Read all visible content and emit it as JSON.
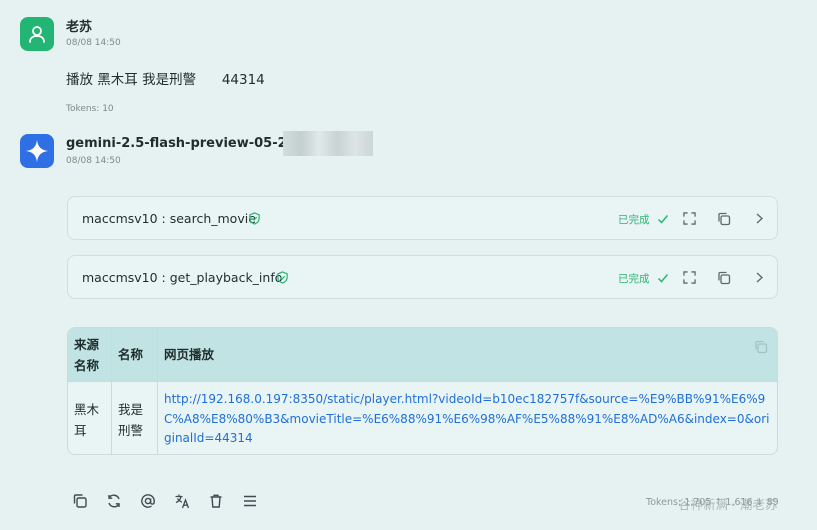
{
  "user": {
    "name": "老苏",
    "time": "08/08 14:50",
    "message": "播放 黑木耳 我是刑警      44314",
    "tokens": "Tokens: 10"
  },
  "bot": {
    "name": "gemini-2.5-flash-preview-05-20 |",
    "time": "08/08 14:50"
  },
  "tools": [
    {
      "label": "maccmsv10 : search_movie",
      "status": "已完成"
    },
    {
      "label": "maccmsv10 : get_playback_info",
      "status": "已完成"
    }
  ],
  "table": {
    "headers": [
      "来源名称",
      "名称",
      "网页播放"
    ],
    "rows": [
      {
        "source": "黑木耳",
        "name": "我是刑警",
        "link": "http://192.168.0.197:8350/static/player.html?videoId=b10ec182757f&source=%E9%BB%91%E6%9C%A8%E8%80%B3&movieTitle=%E6%88%91%E6%98%AF%E5%88%91%E8%AD%A6&index=0&originalId=44314"
      }
    ]
  },
  "footer": {
    "tokens": "Tokens: 1,705 ↑ 1,616 ↓ 89",
    "watermark": "谷神新满 · 潮老苏"
  },
  "colors": {
    "accent_green": "#2bb673",
    "link_blue": "#1f6fd8",
    "user_avatar": "#22b573",
    "bot_avatar": "#2f6fe6"
  }
}
